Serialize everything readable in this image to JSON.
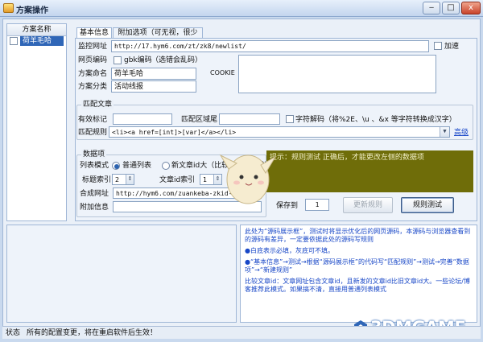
{
  "window": {
    "title": "方案操作",
    "min_label": "‒",
    "max_label": "□",
    "close_label": "x"
  },
  "scheme_list": {
    "header": "方案名称",
    "items": [
      {
        "label": "荷羊毛哈",
        "selected": true
      }
    ]
  },
  "tabs": [
    {
      "label": "基本信息",
      "active": true
    },
    {
      "label": "附加选项（可无视，很少用）",
      "active": false
    }
  ],
  "basic": {
    "monitor_url_label": "监控网址",
    "monitor_url_value": "http://17.hym6.com/zt/zk8/newlist/",
    "add_label": "加速",
    "page_encoding_label": "网页编码",
    "gbk_label": "gbk编码",
    "gbk_hint": "（选错会乱码）",
    "scheme_name_label": "方案命名",
    "scheme_name_value": "荷羊毛哈",
    "cookie_label": "COOKIE",
    "category_label": "方案分类",
    "category_value": "活动线报"
  },
  "match": {
    "group_title": "匹配文章",
    "start_label": "有效标记",
    "start_value": "",
    "end_label": "匹配区域尾",
    "end_value": "",
    "decode_label": "字符解码（将%2E、\\u 、&x 等字符转换成汉字）",
    "rule_label": "匹配规则",
    "rule_value": "<li><a href=[int]>[var]</a></li>",
    "advanced_link": "高级"
  },
  "data": {
    "group_title": "数据项",
    "list_mode_label": "列表模式",
    "radio_normal": "普通列表",
    "radio_id": "新文章id大（比较文章id模式）",
    "title_index_label": "标题索引",
    "title_index_value": "2",
    "article_id_label": "文章id索引",
    "article_id_value": "1",
    "url_label": "合成网址",
    "url_value": "http://hym6.com/zuankeba-zkid-[1].htm",
    "extra_label": "附加信息",
    "extra_value": ""
  },
  "hint": {
    "text": "提示：规则测试 正确后，才能更改左侧的数据项"
  },
  "actions": {
    "save_to_label": "保存到",
    "save_to_value": "1",
    "update_button": "更新规则",
    "test_button": "规则测试"
  },
  "notes": {
    "paragraphs": [
      "此处为“源码展示框”，测试时将显示优化后的网页源码，本源码与浏览器查看到的源码有差异，一定要依据此处的源码写规则",
      "●白底表示必填，灰底可不填。",
      "●“基本信息”→测试→根据“源码展示框”的代码写“匹配规则”→测试→完善“数据项”→“新建规则”",
      "比较文章id：文章网址包含文章id，且新发的文章id比旧文章id大。一些论坛/博客推荐此模式。如果搞不清，直接用普通列表模式"
    ]
  },
  "status": {
    "label": "状态",
    "message": "所有的配置变更，将在重启软件后生效！"
  },
  "watermark": {
    "text": "3DMGAME"
  },
  "colors": {
    "hint_bg": "#6f6d09",
    "selection": "#2f66b7",
    "notes_text": "#1847c7"
  }
}
